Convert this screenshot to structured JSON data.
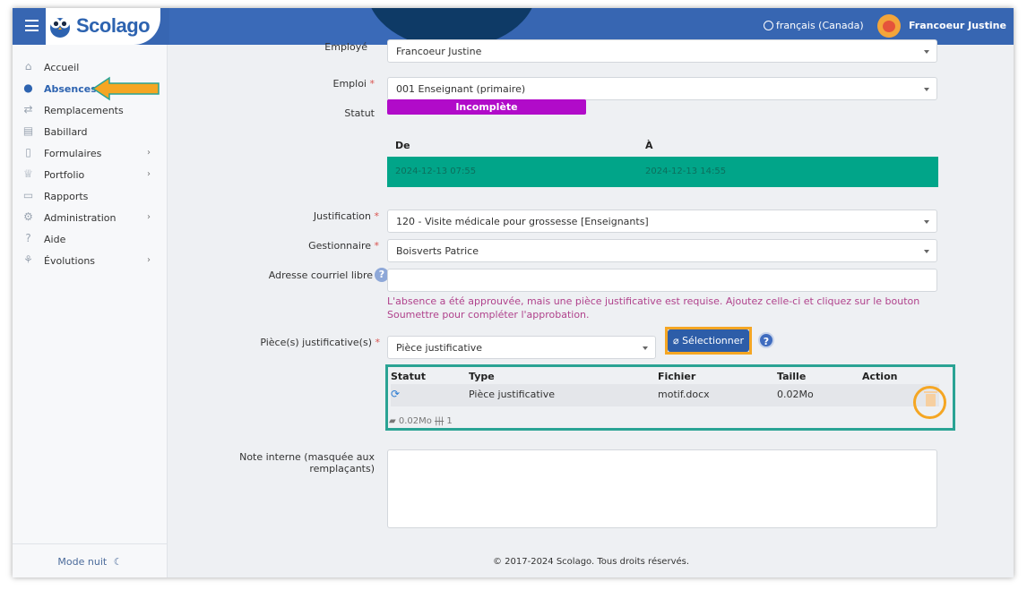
{
  "header": {
    "brand": "Scolago",
    "language": "français (Canada)",
    "user_name": "Francoeur Justine"
  },
  "sidebar": {
    "items": [
      {
        "label": "Accueil",
        "icon": "home-icon"
      },
      {
        "label": "Absences",
        "icon": "user-clock-icon",
        "active": true
      },
      {
        "label": "Remplacements",
        "icon": "swap-icon"
      },
      {
        "label": "Babillard",
        "icon": "board-icon"
      },
      {
        "label": "Formulaires",
        "icon": "file-icon",
        "has_children": true
      },
      {
        "label": "Portfolio",
        "icon": "trophy-icon",
        "has_children": true
      },
      {
        "label": "Rapports",
        "icon": "report-icon"
      },
      {
        "label": "Administration",
        "icon": "gear-icon",
        "has_children": true
      },
      {
        "label": "Aide",
        "icon": "question-icon"
      },
      {
        "label": "Évolutions",
        "icon": "sprout-icon",
        "has_children": true
      }
    ],
    "night_mode": "Mode nuit"
  },
  "form": {
    "employee_label": "Employé",
    "employee_value": "Francoeur Justine",
    "job_label": "Emploi",
    "job_value": "001 Enseignant (primaire)",
    "status_label": "Statut",
    "status_value": "Incomplète",
    "period": {
      "from_header": "De",
      "to_header": "À",
      "from_value": "2024-12-13 07:55",
      "to_value": "2024-12-13 14:55"
    },
    "justification_label": "Justification",
    "justification_value": "120 - Visite médicale pour grossesse [Enseignants]",
    "manager_label": "Gestionnaire",
    "manager_value": "Boisverts Patrice",
    "email_label": "Adresse courriel libre",
    "email_value": "",
    "notice": "L'absence a été approuvée, mais une pièce justificative est requise. Ajoutez celle-ci et cliquez sur le bouton Soumettre pour compléter l'approbation.",
    "attachments_label": "Pièce(s) justificative(s)",
    "attachment_type_value": "Pièce justificative",
    "select_button": "Sélectionner",
    "note_label": "Note interne (masquée aux remplaçants)",
    "note_value": "",
    "required_mark": "*",
    "help_glyph": "?"
  },
  "attachments_table": {
    "headers": [
      "Statut",
      "Type",
      "Fichier",
      "Taille",
      "Action"
    ],
    "rows": [
      {
        "status_icon": "sync-icon",
        "type": "Pièce justificative",
        "file": "motif.docx",
        "size": "0.02Mo"
      }
    ],
    "footer_size": "0.02Mo",
    "footer_count": "1"
  },
  "footer": {
    "copyright": "© 2017-2024 Scolago. Tous droits réservés."
  },
  "colors": {
    "header_bg": "#3766b2",
    "status_badge": "#b10bc9",
    "period_row": "#01a589",
    "highlight_orange": "#f5a623",
    "highlight_teal": "#2aa394",
    "primary_button": "#2d5da8"
  }
}
